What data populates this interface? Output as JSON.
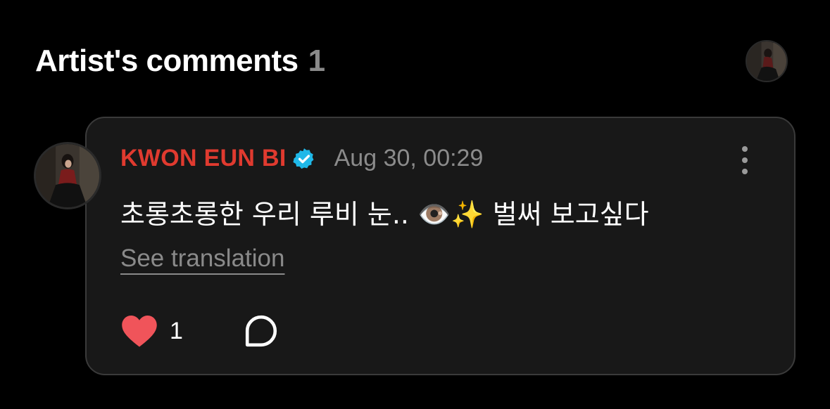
{
  "header": {
    "title": "Artist's comments",
    "count": "1"
  },
  "comment": {
    "author": "KWON EUN BI",
    "timestamp": "Aug 30, 00:29",
    "text": "초롱초롱한 우리 루비 눈.. 👁️✨ 벌써 보고싶다",
    "see_translation": "See translation",
    "like_count": "1"
  },
  "icons": {
    "verified": "verified-badge-icon",
    "more": "more-vertical-icon",
    "like": "heart-icon",
    "reply": "comment-bubble-icon"
  },
  "colors": {
    "background": "#000000",
    "card": "#181818",
    "author": "#e03a2f",
    "verified": "#1fb8e8",
    "heart": "#f0545a",
    "muted": "#8b8b8b"
  }
}
